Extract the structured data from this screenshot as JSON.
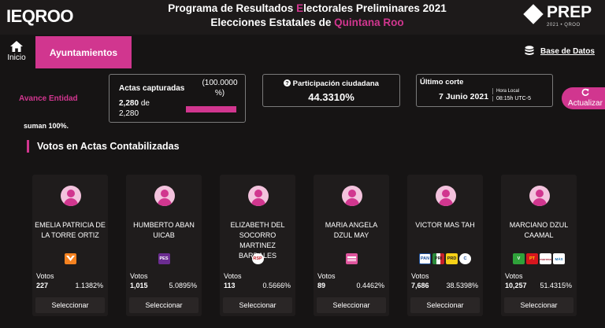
{
  "header": {
    "logo": "IEQROO",
    "title_part1": "Programa de Resultados ",
    "title_accent": "E",
    "title_part2": "lectorales Preliminares 2021",
    "subtitle_part1": "Elecciones Estatales de ",
    "subtitle_accent": "Quintana Roo",
    "prep_word": "PREP",
    "prep_sub": "2021 • QROO"
  },
  "nav": {
    "inicio": "Inicio",
    "tab_active": "Ayuntamientos",
    "base_datos": "Base de Datos"
  },
  "summary": {
    "avance": "Avance Entidad",
    "actas_label": "Actas capturadas",
    "actas_pct": "(100.0000 %)",
    "actas_count": "2,280",
    "actas_de": "de",
    "actas_total": "2,280",
    "actas_progress": 1.0,
    "participacion_label": "Participación ciudadana",
    "participacion_value": "44.3310%",
    "corte_label": "Último corte",
    "corte_date": "7 Junio 2021",
    "hora_local_label": "Hora Local",
    "hora_local_value": "08:15h UTC-5",
    "actualizar": "Actualizar",
    "suman": "suman 100%."
  },
  "section_title": "Votos en Actas Contabilizadas",
  "candidates": [
    {
      "name": "EMELIA PATRICIA DE LA TORRE ORTIZ",
      "votes_label": "Votos",
      "votes": "227",
      "pct": "1.1382%",
      "button": "Seleccionar"
    },
    {
      "name": "HUMBERTO ABAN UICAB",
      "votes_label": "Votos",
      "votes": "1,015",
      "pct": "5.0895%",
      "button": "Seleccionar"
    },
    {
      "name": "ELIZABETH DEL SOCORRO MARTINEZ BARDALES",
      "votes_label": "Votos",
      "votes": "113",
      "pct": "0.5666%",
      "button": "Seleccionar"
    },
    {
      "name": "MARIA ANGELA DZUL MAY",
      "votes_label": "Votos",
      "votes": "89",
      "pct": "0.4462%",
      "button": "Seleccionar"
    },
    {
      "name": "VICTOR MAS TAH",
      "votes_label": "Votos",
      "votes": "7,686",
      "pct": "38.5398%",
      "button": "Seleccionar"
    },
    {
      "name": "MARCIANO DZUL CAAMAL",
      "votes_label": "Votos",
      "votes": "10,257",
      "pct": "51.4315%",
      "button": "Seleccionar"
    }
  ],
  "party_logos": {
    "c0": [
      {
        "icon": "movimiento-ciudadano-logo",
        "color": "#f58220",
        "text": ""
      }
    ],
    "c1": [
      {
        "icon": "pes-logo",
        "color": "#6b2c91",
        "text": "PES"
      }
    ],
    "c2": [
      {
        "icon": "rsp-logo",
        "color": "#ffffff",
        "text": "RSP"
      }
    ],
    "c3": [
      {
        "icon": "fuerza-por-mexico-logo",
        "color": "#e0559e",
        "text": ""
      }
    ],
    "c4": [
      {
        "icon": "pan-logo",
        "color": "#1a4f9c",
        "text": "PAN"
      },
      {
        "icon": "pri-logo",
        "color": "#ffffff",
        "text": "PRI"
      },
      {
        "icon": "prd-logo",
        "color": "#f7d117",
        "text": "PRD"
      },
      {
        "icon": "confianza-logo",
        "color": "#ffffff",
        "text": "C"
      }
    ],
    "c5": [
      {
        "icon": "pvem-logo",
        "color": "#2fa23a",
        "text": "V"
      },
      {
        "icon": "pt-logo",
        "color": "#d7161e",
        "text": "PT"
      },
      {
        "icon": "morena-logo",
        "color": "#ffffff",
        "text": "morena"
      },
      {
        "icon": "mas-logo",
        "color": "#ffffff",
        "text": "MÁS"
      }
    ]
  },
  "colors": {
    "accent": "#d1368f",
    "background": "#161414",
    "card": "#1f1c1c"
  }
}
